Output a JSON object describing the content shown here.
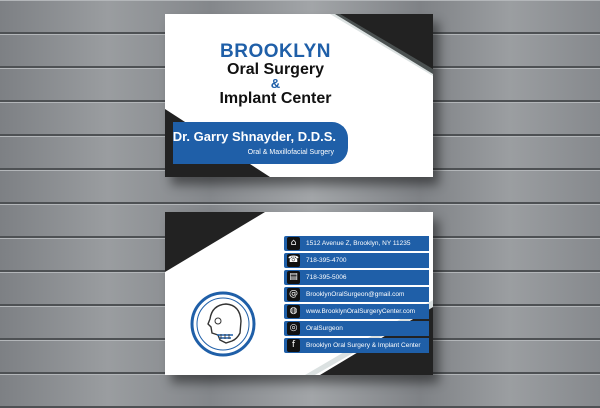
{
  "front": {
    "title_line1": "BROOKLYN",
    "title_line2": "Oral Surgery",
    "title_amp": "&",
    "title_line3": "Implant Center",
    "doctor_name": "Dr. Garry Shnayder, D.D.S.",
    "specialty": "Oral & Maxillofacial Surgery"
  },
  "back": {
    "contacts": [
      {
        "icon": "home-icon",
        "glyph": "⌂",
        "text": "1512 Avenue Z, Brooklyn, NY 11235"
      },
      {
        "icon": "phone-icon",
        "glyph": "☎",
        "text": "718-395-4700"
      },
      {
        "icon": "fax-icon",
        "glyph": "▤",
        "text": "718-395-5006"
      },
      {
        "icon": "email-icon",
        "glyph": "@",
        "text": "BrooklynOralSurgeon@gmail.com"
      },
      {
        "icon": "globe-icon",
        "glyph": "◍",
        "text": "www.BrooklynOralSurgeryCenter.com"
      },
      {
        "icon": "instagram-icon",
        "glyph": "◎",
        "text": "OralSurgeon"
      },
      {
        "icon": "facebook-icon",
        "glyph": "f",
        "text": "Brooklyn Oral Surgery & Implant Center"
      }
    ]
  },
  "colors": {
    "brand_blue": "#1f5fa8",
    "dark": "#222222",
    "card": "#ffffff"
  }
}
